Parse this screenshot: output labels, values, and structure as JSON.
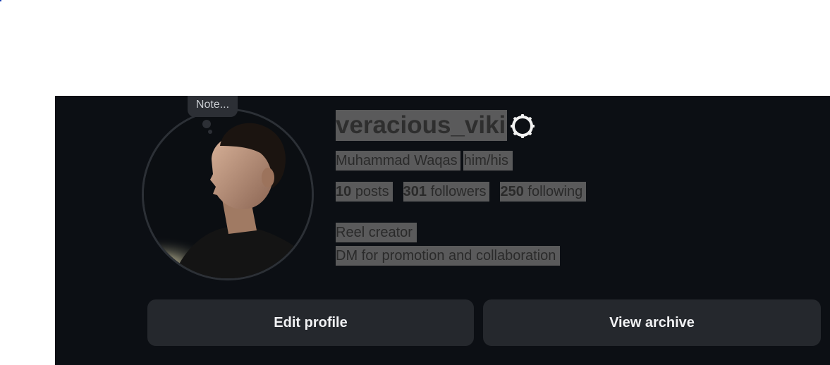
{
  "profile": {
    "username": "veracious_viki",
    "full_name": "Muhammad Waqas",
    "pronouns": "him/his",
    "note_placeholder": "Note...",
    "stats": {
      "posts_count": "10",
      "posts_label": "posts",
      "followers_count": "301",
      "followers_label": "followers",
      "following_count": "250",
      "following_label": "following"
    },
    "bio": {
      "line1": "Reel creator",
      "line2": "DM for promotion and collaboration"
    }
  },
  "actions": {
    "edit_profile": "Edit profile",
    "view_archive": "View archive"
  },
  "icons": {
    "settings": "gear-icon"
  },
  "colors": {
    "panel_bg": "#0c0f14",
    "button_bg": "#25282d",
    "text_highlight": "#5a5a5b"
  }
}
